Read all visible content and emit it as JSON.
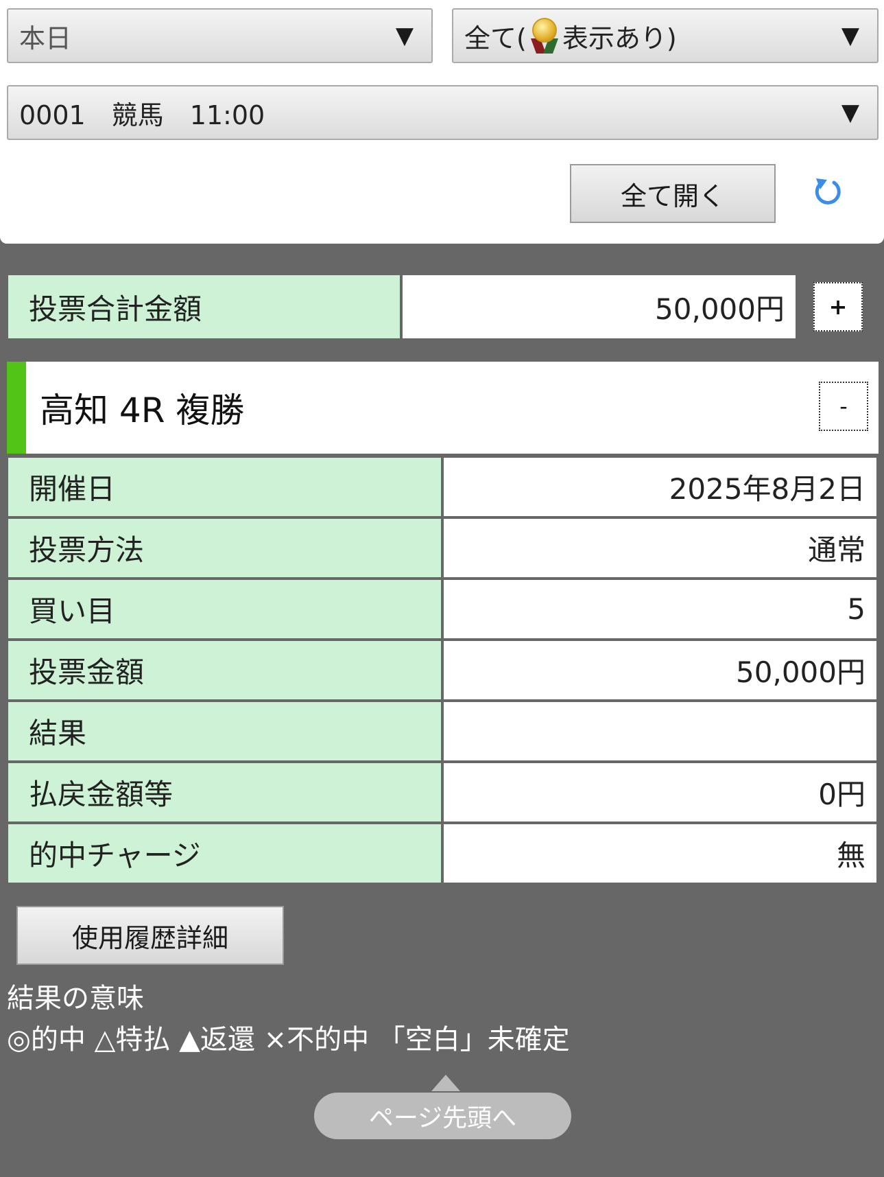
{
  "filters": {
    "period": {
      "value": "本日",
      "arrow": "▼"
    },
    "display": {
      "value_prefix": "全て(",
      "value_suffix": "表示あり)",
      "icon": "medal-icon",
      "arrow": "▼"
    },
    "account": {
      "value": "0001　競馬　11:00",
      "arrow": "▼"
    }
  },
  "actions": {
    "open_all_label": "全て開く",
    "refresh_icon": "refresh-icon"
  },
  "total": {
    "label": "投票合計金額",
    "value": "50,000円",
    "toggle": "+"
  },
  "race": {
    "title": "高知 4R 複勝",
    "toggle": "-",
    "accent_color": "#52c416",
    "rows": [
      {
        "label": "開催日",
        "value": "2025年8月2日"
      },
      {
        "label": "投票方法",
        "value": "通常"
      },
      {
        "label": "買い目",
        "value": "5"
      },
      {
        "label": "投票金額",
        "value": "50,000円"
      },
      {
        "label": "結果",
        "value": ""
      },
      {
        "label": "払戻金額等",
        "value": "0円"
      },
      {
        "label": "的中チャージ",
        "value": "無"
      }
    ]
  },
  "history_button_label": "使用履歴詳細",
  "legend": {
    "title": "結果の意味",
    "line": "◎的中 △特払 ▲返還 ×不的中 「空白」未確定"
  },
  "page_top_label": "ページ先頭へ",
  "colors": {
    "background": "#676767",
    "label_cell": "#cdf2d5",
    "accent": "#52c416",
    "refresh": "#3a8ee6"
  }
}
